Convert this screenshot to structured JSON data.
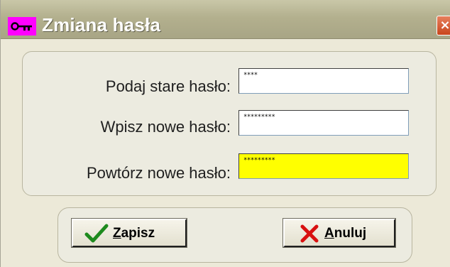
{
  "window": {
    "title": "Zmiana hasła",
    "close_symbol": "×"
  },
  "form": {
    "old_password": {
      "label": "Podaj stare hasło:",
      "value": "****"
    },
    "new_password": {
      "label": "Wpisz nowe hasło:",
      "value": "*********"
    },
    "repeat_password": {
      "label": "Powtórz nowe hasło:",
      "value": "*********"
    }
  },
  "buttons": {
    "save": {
      "mnemonic": "Z",
      "rest": "apisz",
      "icon": "checkmark-icon"
    },
    "cancel": {
      "mnemonic": "A",
      "rest": "nuluj",
      "icon": "x-icon"
    }
  },
  "colors": {
    "title_icon_bg": "#ff00ff",
    "focused_field_bg": "#ffff00",
    "save_icon": "#1d8a1d",
    "cancel_icon": "#d81010"
  }
}
